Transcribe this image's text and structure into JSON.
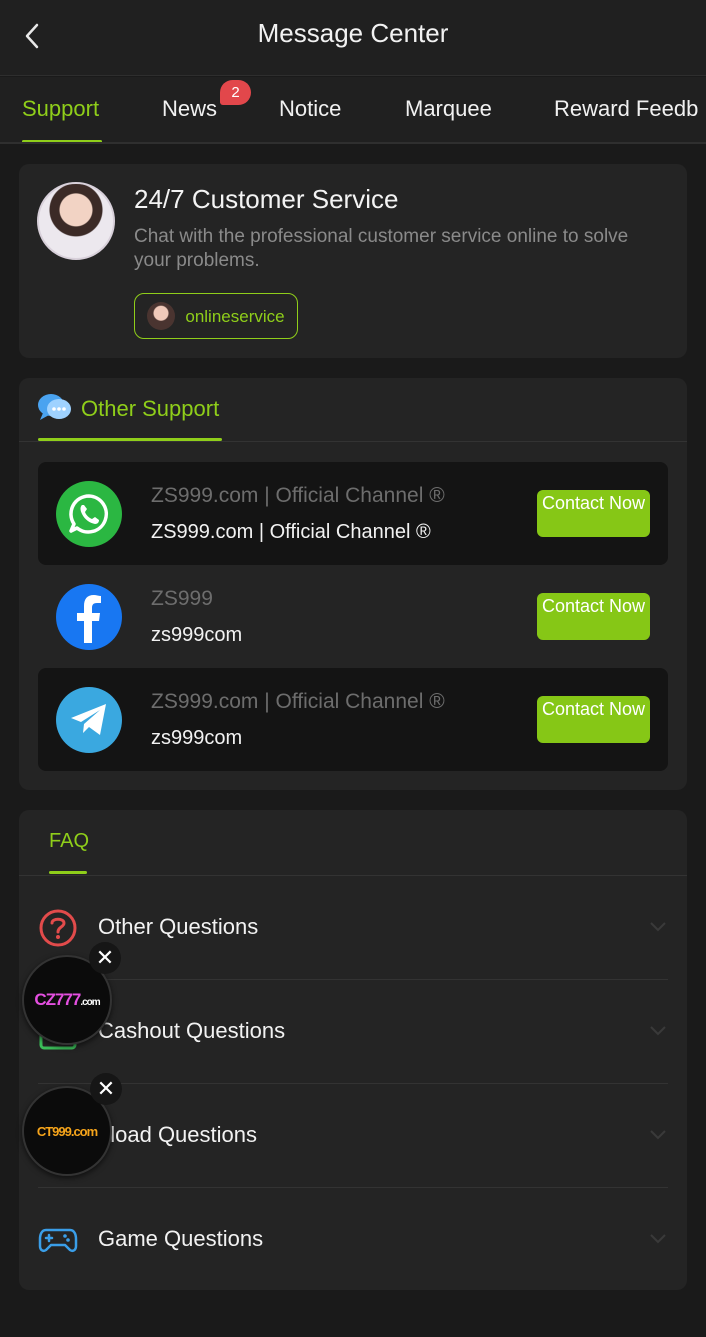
{
  "header": {
    "title": "Message Center",
    "back_icon": "chevron-left-icon"
  },
  "tabs": [
    {
      "label": "Support",
      "active": true
    },
    {
      "label": "News",
      "badge": "2"
    },
    {
      "label": "Notice"
    },
    {
      "label": "Marquee"
    },
    {
      "label": "Reward Feedb"
    }
  ],
  "customer_service": {
    "title": "24/7 Customer Service",
    "description": "Chat with the professional customer service online to solve your problems.",
    "button_label": "onlineservice"
  },
  "other_support": {
    "title": "Other Support",
    "channels": [
      {
        "icon": "whatsapp-icon",
        "name": "ZS999.com | Official Channel ®",
        "handle": "ZS999.com | Official Channel ®",
        "button": "Contact Now"
      },
      {
        "icon": "facebook-icon",
        "name": "ZS999",
        "handle": "zs999com",
        "button": "Contact Now"
      },
      {
        "icon": "telegram-icon",
        "name": "ZS999.com | Official Channel ®",
        "handle": "zs999com",
        "button": "Contact Now"
      }
    ]
  },
  "faq": {
    "title": "FAQ",
    "items": [
      {
        "label": "Other Questions",
        "icon": "question-circle-icon"
      },
      {
        "label": "Cashout Questions",
        "icon": "cashout-icon"
      },
      {
        "label": "eload Questions",
        "icon": "reload-icon"
      },
      {
        "label": "Game Questions",
        "icon": "gamepad-icon"
      }
    ]
  },
  "floating_ads": [
    {
      "label": "CZ777",
      "suffix": ".com"
    },
    {
      "label": "CT999.com"
    }
  ],
  "colors": {
    "accent": "#8fce1a",
    "background": "#1a1a1a",
    "card": "#242424",
    "badge": "#e2474b"
  }
}
